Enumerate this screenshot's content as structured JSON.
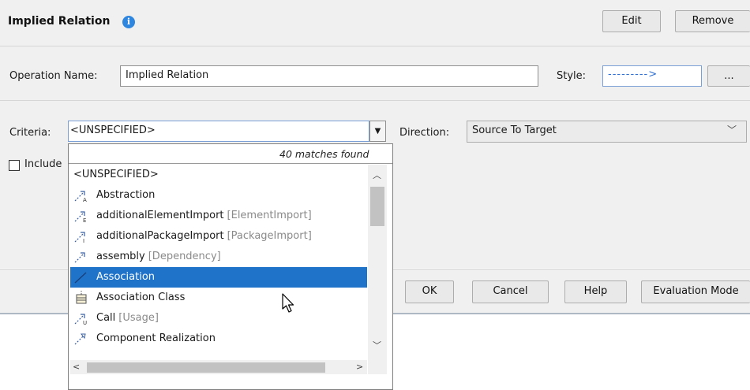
{
  "header": {
    "title": "Implied Relation",
    "edit_label": "Edit",
    "remove_label": "Remove"
  },
  "operation": {
    "label": "Operation Name:",
    "value": "Implied Relation"
  },
  "style": {
    "label": "Style:",
    "value": "--------->",
    "more_label": "..."
  },
  "criteria": {
    "label": "Criteria:",
    "value": "<UNSPECIFIED>"
  },
  "direction": {
    "label": "Direction:",
    "value": "Source To Target"
  },
  "include": {
    "label": "Include"
  },
  "popup": {
    "matches": "40 matches found",
    "items": [
      {
        "name": "<UNSPECIFIED>",
        "type": "",
        "icon": "none"
      },
      {
        "name": "Abstraction",
        "type": "",
        "icon": "abstraction-icon"
      },
      {
        "name": "additionalElementImport",
        "type": "[ElementImport]",
        "icon": "element-import-icon"
      },
      {
        "name": "additionalPackageImport",
        "type": "[PackageImport]",
        "icon": "package-import-icon"
      },
      {
        "name": "assembly",
        "type": "[Dependency]",
        "icon": "dependency-icon"
      },
      {
        "name": "Association",
        "type": "",
        "icon": "association-icon",
        "selected": true
      },
      {
        "name": "Association Class",
        "type": "",
        "icon": "association-class-icon"
      },
      {
        "name": "Call",
        "type": "[Usage]",
        "icon": "usage-icon"
      },
      {
        "name": "Component Realization",
        "type": "",
        "icon": "component-realization-icon"
      }
    ]
  },
  "buttons": {
    "ok": "OK",
    "cancel": "Cancel",
    "help": "Help",
    "evaluation_mode": "Evaluation Mode"
  },
  "colors": {
    "accent": "#1f73c9",
    "info": "#2e86de",
    "panel": "#f0f0f0"
  }
}
